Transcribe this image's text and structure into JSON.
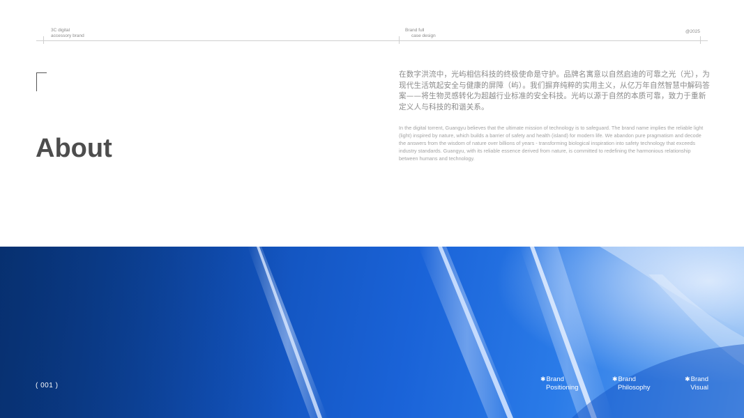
{
  "header": {
    "left_line1": "3C digital",
    "left_line2": "accessory brand",
    "mid_line1": "Brand full",
    "mid_line2": "case design",
    "right": "@2025"
  },
  "section_title": "About",
  "body_cn": "在数字洪流中，光屿相信科技的终极使命是守护。品牌名寓意以自然启迪的可靠之光（光），为现代生活筑起安全与健康的屏障（屿）。我们摒弃纯粹的实用主义，从亿万年自然智慧中解码答案——将生物灵感转化为超越行业标准的安全科技。光屿以源于自然的本质可靠，致力于重新定义人与科技的和谐关系。",
  "body_en": "In the digital torrent, Guangyu believes that the ultimate mission of technology is to safeguard. The brand name implies the reliable light (light) inspired by nature, which builds a barrier of safety and health (island) for modern life. We abandon pure pragmatism and decode the answers from the wisdom of nature over billions of years - transforming biological inspiration into safety technology that exceeds industry standards. Guangyu, with its reliable essence derived from nature, is committed to redefining the harmonious relationship between humans and technology.",
  "footer": {
    "page_number": "( 001 )",
    "nav": [
      {
        "star": "✱",
        "line1": "Brand",
        "line2": "Positioning"
      },
      {
        "star": "✱",
        "line1": "Brand",
        "line2": "Philosophy"
      },
      {
        "star": "✱",
        "line1": "Brand",
        "line2": "Visual"
      }
    ]
  },
  "colors": {
    "band_dark": "#0a3a86",
    "band_mid": "#1a63d8",
    "band_light": "#6aa8f0",
    "title": "#4d4d4d"
  }
}
